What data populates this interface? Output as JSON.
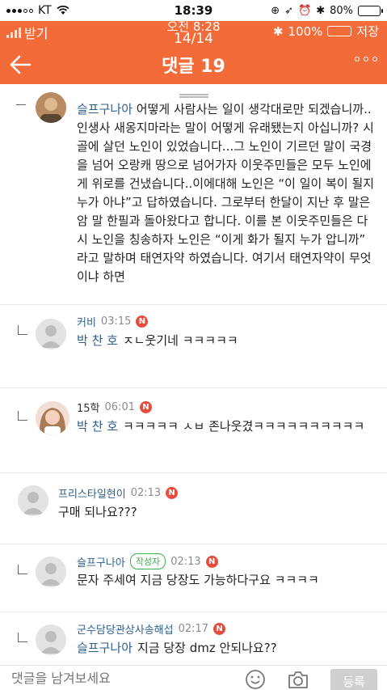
{
  "status_bar": {
    "carrier": "KT",
    "time": "18:39",
    "battery": "80%",
    "battery_fraction": 0.8
  },
  "inner_status": {
    "left_label": "받기",
    "time": "오전 8:28",
    "page": "14/14",
    "battery": "100%",
    "right_label": "저장"
  },
  "header": {
    "title": "댓글 19"
  },
  "comments": [
    {
      "nickname": "슬프구나아",
      "text": "어떻게 사람사는 일이 생각대로만 되겠습니까..인생사 새옹지마라는 말이 어떻게 유래됐는지 아십니까? 시골에 살던 노인이 있었습니다...그 노인이 기르던 말이 국경을 넘어 오랑캐 땅으로 넘어가자 이웃주민들은 모두 노인에게 위로를 건냈습니다..이에대해 노인은 “이 일이 복이 될지 누가 아냐”고 답하였습니다. 그로부터 한달이 지난 후 말은 암 말 한필과 돌아왔다고 합니다. 이를 본 이웃주민들은 다시 노인을 칭송하자 노인은 “이게 화가 될지 누가 압니까” 라고 말하며 태연자약 하였습니다. 여기서 태연자약이 무엇이냐 하면"
    },
    {
      "nickname": "커비",
      "time": "03:15",
      "badge": "N",
      "mention": "박 찬 호",
      "text": "ㅈㄴ웃기네 ㅋㅋㅋㅋㅋ"
    },
    {
      "nickname": "15학",
      "time": "06:01",
      "badge": "N",
      "mention": "박 찬 호",
      "text": "ㅋㅋㅋㅋㅋ ㅅㅂ 존나웃겼ㅋㅋㅋㅋㅋㅋㅋㅋㅋㅋ"
    },
    {
      "nickname": "프리스타일현이",
      "time": "02:13",
      "badge": "N",
      "text": "구매 되나요???"
    },
    {
      "nickname": "슬프구나아",
      "author_label": "작성자",
      "time": "02:13",
      "badge": "N",
      "text": "문자 주세여 지금 당장도 가능하다구요 ㅋㅋㅋㅋ"
    },
    {
      "nickname": "군수담당관상사송해섭",
      "time": "02:17",
      "badge": "N",
      "mention": "슬프구나아",
      "text": "지금 당장 dmz 안되나요??"
    }
  ],
  "input": {
    "placeholder": "댓글을 남겨보세요",
    "submit_label": "등록"
  },
  "colors": {
    "header": "#f26b38",
    "nickname": "#2d5f8f",
    "badge": "#e74c3c",
    "author_badge": "#38b24b"
  },
  "icons": [
    "back-arrow-icon",
    "more-icon",
    "default-avatar-icon",
    "emoji-icon",
    "camera-icon"
  ]
}
